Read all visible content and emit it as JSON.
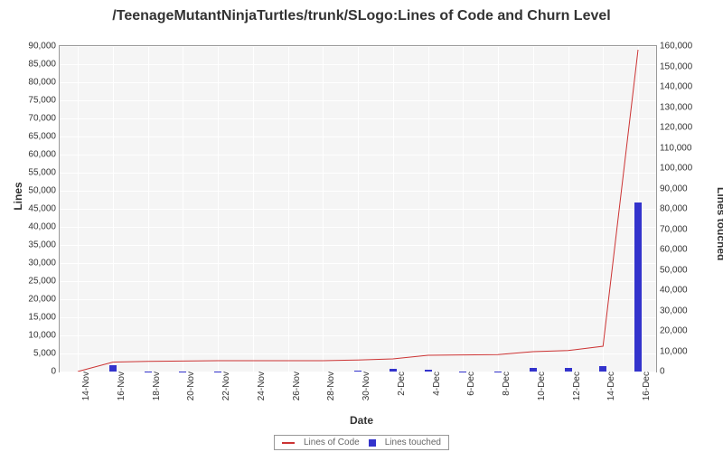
{
  "chart_data": {
    "type": "bar",
    "title": "/TeenageMutantNinjaTurtles/trunk/SLogo:Lines of Code and Churn Level",
    "xlabel": "Date",
    "ylabel_left": "Lines",
    "ylabel_right": "Lines touched",
    "categories": [
      "14-Nov",
      "16-Nov",
      "18-Nov",
      "20-Nov",
      "22-Nov",
      "24-Nov",
      "26-Nov",
      "28-Nov",
      "30-Nov",
      "2-Dec",
      "4-Dec",
      "6-Dec",
      "8-Dec",
      "10-Dec",
      "12-Dec",
      "14-Dec",
      "16-Dec"
    ],
    "series": [
      {
        "name": "Lines of Code",
        "values": [
          0,
          2600,
          2800,
          2900,
          3000,
          3000,
          3000,
          3000,
          3200,
          3500,
          4500,
          4600,
          4700,
          5500,
          5800,
          7000,
          89000
        ]
      },
      {
        "name": "Lines touched",
        "values": [
          0,
          3000,
          200,
          100,
          100,
          0,
          0,
          0,
          400,
          1200,
          1000,
          100,
          100,
          2000,
          1800,
          2500,
          83000
        ]
      }
    ],
    "ylim_left": [
      0,
      90000
    ],
    "ylim_right": [
      0,
      160000
    ],
    "y_ticks_left": [
      "0",
      "5,000",
      "10,000",
      "15,000",
      "20,000",
      "25,000",
      "30,000",
      "35,000",
      "40,000",
      "45,000",
      "50,000",
      "55,000",
      "60,000",
      "65,000",
      "70,000",
      "75,000",
      "80,000",
      "85,000",
      "90,000"
    ],
    "y_ticks_right": [
      "0",
      "10,000",
      "20,000",
      "30,000",
      "40,000",
      "50,000",
      "60,000",
      "70,000",
      "80,000",
      "90,000",
      "100,000",
      "110,000",
      "120,000",
      "130,000",
      "140,000",
      "150,000",
      "160,000"
    ],
    "legend": [
      "Lines of Code",
      "Lines touched"
    ]
  }
}
